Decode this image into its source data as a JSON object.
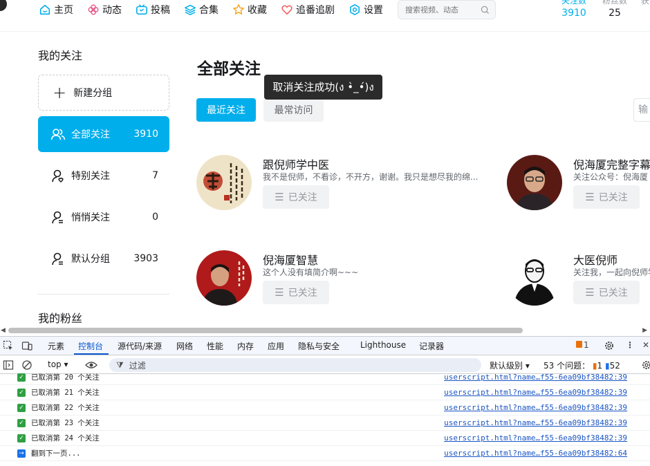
{
  "nav": {
    "items": [
      {
        "label": "主页",
        "icon": "home-icon"
      },
      {
        "label": "动态",
        "icon": "pinwheel-icon"
      },
      {
        "label": "投稿",
        "icon": "tv-icon"
      },
      {
        "label": "合集",
        "icon": "layers-icon"
      },
      {
        "label": "收藏",
        "icon": "star-icon"
      },
      {
        "label": "追番追剧",
        "icon": "heart-icon"
      },
      {
        "label": "设置",
        "icon": "gear-icon"
      }
    ],
    "search_placeholder": "搜索视频、动态",
    "stats": [
      {
        "label": "关注数",
        "value": "3910"
      },
      {
        "label": "粉丝数",
        "value": "25"
      },
      {
        "label": "获"
      }
    ]
  },
  "sidebar": {
    "title": "我的关注",
    "new_group_label": "新建分组",
    "groups": [
      {
        "name": "全部关注",
        "count": "3910"
      },
      {
        "name": "特别关注",
        "count": "7"
      },
      {
        "name": "悄悄关注",
        "count": "0"
      },
      {
        "name": "默认分组",
        "count": "3903"
      }
    ],
    "fans_title": "我的粉丝"
  },
  "main": {
    "title": "全部关注",
    "toast": "取消关注成功(ง •̀_•́)ง",
    "tabs": [
      "最近关注",
      "最常访问"
    ],
    "search_partial": "输",
    "follow_label": "已关注",
    "cards": [
      {
        "name": "跟倪师学中医",
        "sign": "我不是倪师，不看诊，不开方，谢谢。我只是想尽我的绵..."
      },
      {
        "name": "倪海厦完整字幕",
        "sign": "关注公众号：倪海厦"
      },
      {
        "name": "倪海厦智慧",
        "sign": "这个人没有填简介啊~~~"
      },
      {
        "name": "大医倪师",
        "sign": "关注我，一起向倪师学"
      }
    ]
  },
  "devtools": {
    "tabs": [
      "元素",
      "控制台",
      "源代码/来源",
      "网络",
      "性能",
      "内存",
      "应用",
      "隐私与安全",
      "Lighthouse",
      "记录器"
    ],
    "active_tab": "控制台",
    "issues_badge": "1",
    "context": "top",
    "filter_placeholder": "过滤",
    "level_select": "默认级别",
    "issues_summary": "53 个问题：",
    "issues_error_count": "1",
    "issues_info_count": "52",
    "logs": [
      {
        "msg": "已取消第 20 个关注",
        "src": "userscript.html?name…f55-6ea09bf38482:39",
        "type": "success"
      },
      {
        "msg": "已取消第 21 个关注",
        "src": "userscript.html?name…f55-6ea09bf38482:39",
        "type": "success"
      },
      {
        "msg": "已取消第 22 个关注",
        "src": "userscript.html?name…f55-6ea09bf38482:39",
        "type": "success"
      },
      {
        "msg": "已取消第 23 个关注",
        "src": "userscript.html?name…f55-6ea09bf38482:39",
        "type": "success"
      },
      {
        "msg": "已取消第 24 个关注",
        "src": "userscript.html?name…f55-6ea09bf38482:39",
        "type": "success"
      },
      {
        "msg": "翻到下一页...",
        "src": "userscript.html?name…f55-6ea09bf38482:64",
        "type": "info"
      }
    ]
  },
  "colors": {
    "accent": "#00aeec",
    "nav_icon": "#00aeec",
    "devtools_link": "#1a55c4",
    "success": "#2ea043"
  }
}
